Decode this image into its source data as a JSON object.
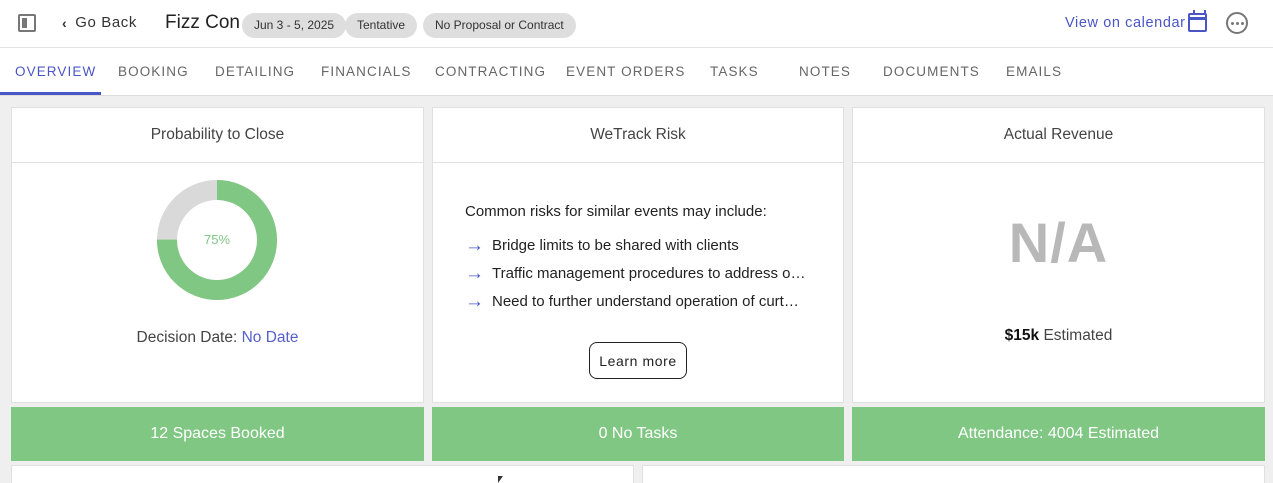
{
  "header": {
    "go_back_label": "Go Back",
    "event_title": "Fizz Con",
    "badges": [
      "Jun 3 - 5, 2025",
      "Tentative",
      "No Proposal or Contract"
    ],
    "view_calendar_label": "View on calendar"
  },
  "tabs": [
    "OVERVIEW",
    "BOOKING",
    "DETAILING",
    "FINANCIALS",
    "CONTRACTING",
    "EVENT ORDERS",
    "TASKS",
    "NOTES",
    "DOCUMENTS",
    "EMAILS"
  ],
  "active_tab": "OVERVIEW",
  "probability": {
    "title": "Probability to Close",
    "percent_label": "75%",
    "percent": 75,
    "decision_label": "Decision Date:",
    "decision_value": "No Date"
  },
  "risk": {
    "title": "WeTrack Risk",
    "intro": "Common risks for similar events may include:",
    "items": [
      "Bridge limits to be shared with clients",
      "Traffic management procedures to address o…",
      "Need to further understand operation of curt…"
    ],
    "learn_more_label": "Learn more"
  },
  "revenue": {
    "title": "Actual Revenue",
    "actual": "N/A",
    "estimated_amount": "$15k",
    "estimated_label": "Estimated"
  },
  "summary_bars": [
    "12 Spaces Booked",
    "0 No Tasks",
    "Attendance: 4004 Estimated"
  ],
  "colors": {
    "accent": "#4a55c6",
    "green": "#80c783",
    "donut_remaining": "#d9d9d9"
  }
}
